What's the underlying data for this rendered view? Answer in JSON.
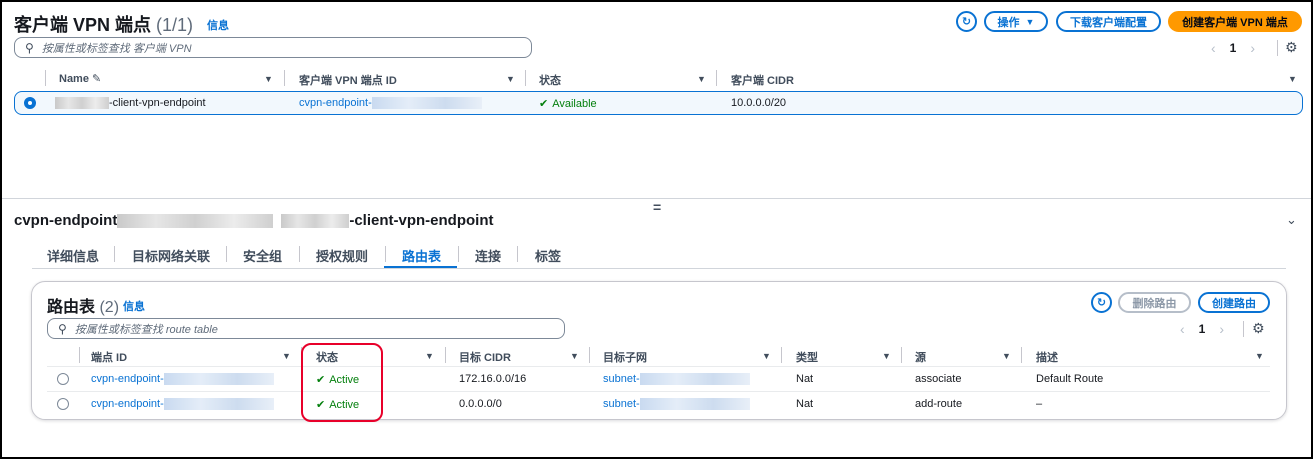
{
  "top": {
    "title": "客户端 VPN 端点",
    "count": "(1/1)",
    "info": "信息",
    "search_placeholder": "按属性或标签查找 客户端 VPN",
    "actions_label": "操作",
    "download_label": "下载客户端配置",
    "create_label": "创建客户端 VPN 端点",
    "page": "1",
    "columns": [
      "Name",
      "客户端 VPN 端点 ID",
      "状态",
      "客户端 CIDR"
    ],
    "row": {
      "name_suffix": "-client-vpn-endpoint",
      "id_prefix": "cvpn-endpoint-",
      "status": "Available",
      "cidr": "10.0.0.0/20"
    }
  },
  "splitter": "=",
  "detail": {
    "title_prefix": "cvpn-endpoint",
    "title_suffix": "-client-vpn-endpoint",
    "tabs": [
      "详细信息",
      "目标网络关联",
      "安全组",
      "授权规则",
      "路由表",
      "连接",
      "标签"
    ],
    "active_tab": "路由表"
  },
  "routes": {
    "title": "路由表",
    "count": "(2)",
    "info": "信息",
    "search_placeholder": "按属性或标签查找 route table",
    "delete_label": "删除路由",
    "create_label": "创建路由",
    "page": "1",
    "columns": [
      "端点 ID",
      "状态",
      "目标 CIDR",
      "目标子网",
      "类型",
      "源",
      "描述"
    ],
    "rows": [
      {
        "endpoint": "cvpn-endpoint-",
        "status": "Active",
        "cidr": "172.16.0.0/16",
        "subnet": "subnet-",
        "type": "Nat",
        "source": "associate",
        "desc": "Default Route"
      },
      {
        "endpoint": "cvpn-endpoint-",
        "status": "Active",
        "cidr": "0.0.0.0/0",
        "subnet": "subnet-",
        "type": "Nat",
        "source": "add-route",
        "desc": "–"
      }
    ]
  },
  "colors": {
    "accent": "#0972d3",
    "primary": "#ff9900",
    "success": "#037f0c",
    "highlight": "#e8002a"
  }
}
